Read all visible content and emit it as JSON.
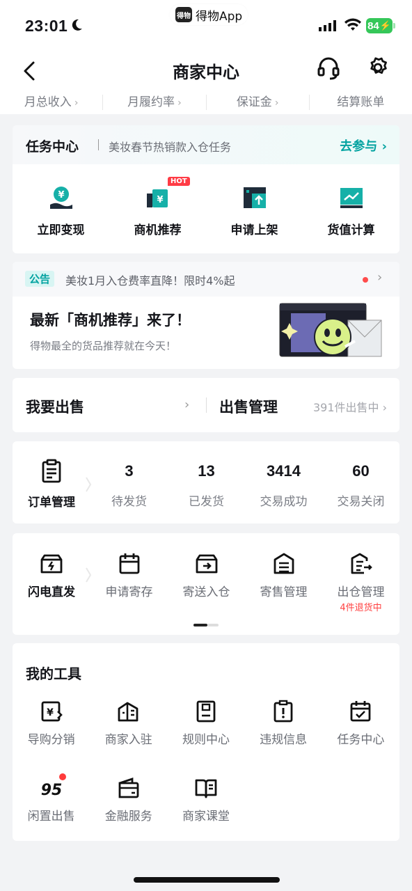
{
  "status_bar": {
    "time": "23:01",
    "app_name": "得物App",
    "app_logo_text": "得物",
    "battery": "84"
  },
  "nav": {
    "title": "商家中心"
  },
  "summary": [
    "月总收入",
    "月履约率",
    "保证金",
    "结算账单"
  ],
  "task_center": {
    "title": "任务中心",
    "subtitle": "美妆春节热销款入仓任务",
    "join_label": "去参与",
    "items": [
      {
        "label": "立即变现",
        "icon": "yuan-hand-icon"
      },
      {
        "label": "商机推荐",
        "icon": "yuan-chart-icon",
        "badge": "HOT"
      },
      {
        "label": "申请上架",
        "icon": "shelf-up-icon"
      },
      {
        "label": "货值计算",
        "icon": "trend-chart-icon"
      }
    ]
  },
  "notice": {
    "tag": "公告",
    "text": "美妆1月入仓费率直降！限时4%起",
    "banner_title": "最新「商机推荐」来了！",
    "banner_subtitle": "得物最全的货品推荐就在今天！"
  },
  "sell": {
    "left_label": "我要出售",
    "right_label": "出售管理",
    "count": "391件出售中"
  },
  "orders": {
    "head_label": "订单管理",
    "stats": [
      {
        "value": "3",
        "label": "待发货"
      },
      {
        "value": "13",
        "label": "已发货"
      },
      {
        "value": "3414",
        "label": "交易成功"
      },
      {
        "value": "60",
        "label": "交易关闭"
      }
    ]
  },
  "flash": {
    "head_label": "闪电直发",
    "items": [
      {
        "label": "申请寄存",
        "sub": ""
      },
      {
        "label": "寄送入仓",
        "sub": ""
      },
      {
        "label": "寄售管理",
        "sub": ""
      },
      {
        "label": "出仓管理",
        "sub": "4件退货中"
      }
    ]
  },
  "tools": {
    "title": "我的工具",
    "items": [
      {
        "label": "导购分销"
      },
      {
        "label": "商家入驻"
      },
      {
        "label": "规则中心"
      },
      {
        "label": "违规信息"
      },
      {
        "label": "任务中心"
      },
      {
        "label": "闲置出售",
        "icon_text": "95"
      },
      {
        "label": "金融服务"
      },
      {
        "label": "商家课堂"
      }
    ]
  },
  "colors": {
    "accent": "#01a2a0",
    "alert": "#ff4040",
    "background": "#f2f3f5"
  }
}
